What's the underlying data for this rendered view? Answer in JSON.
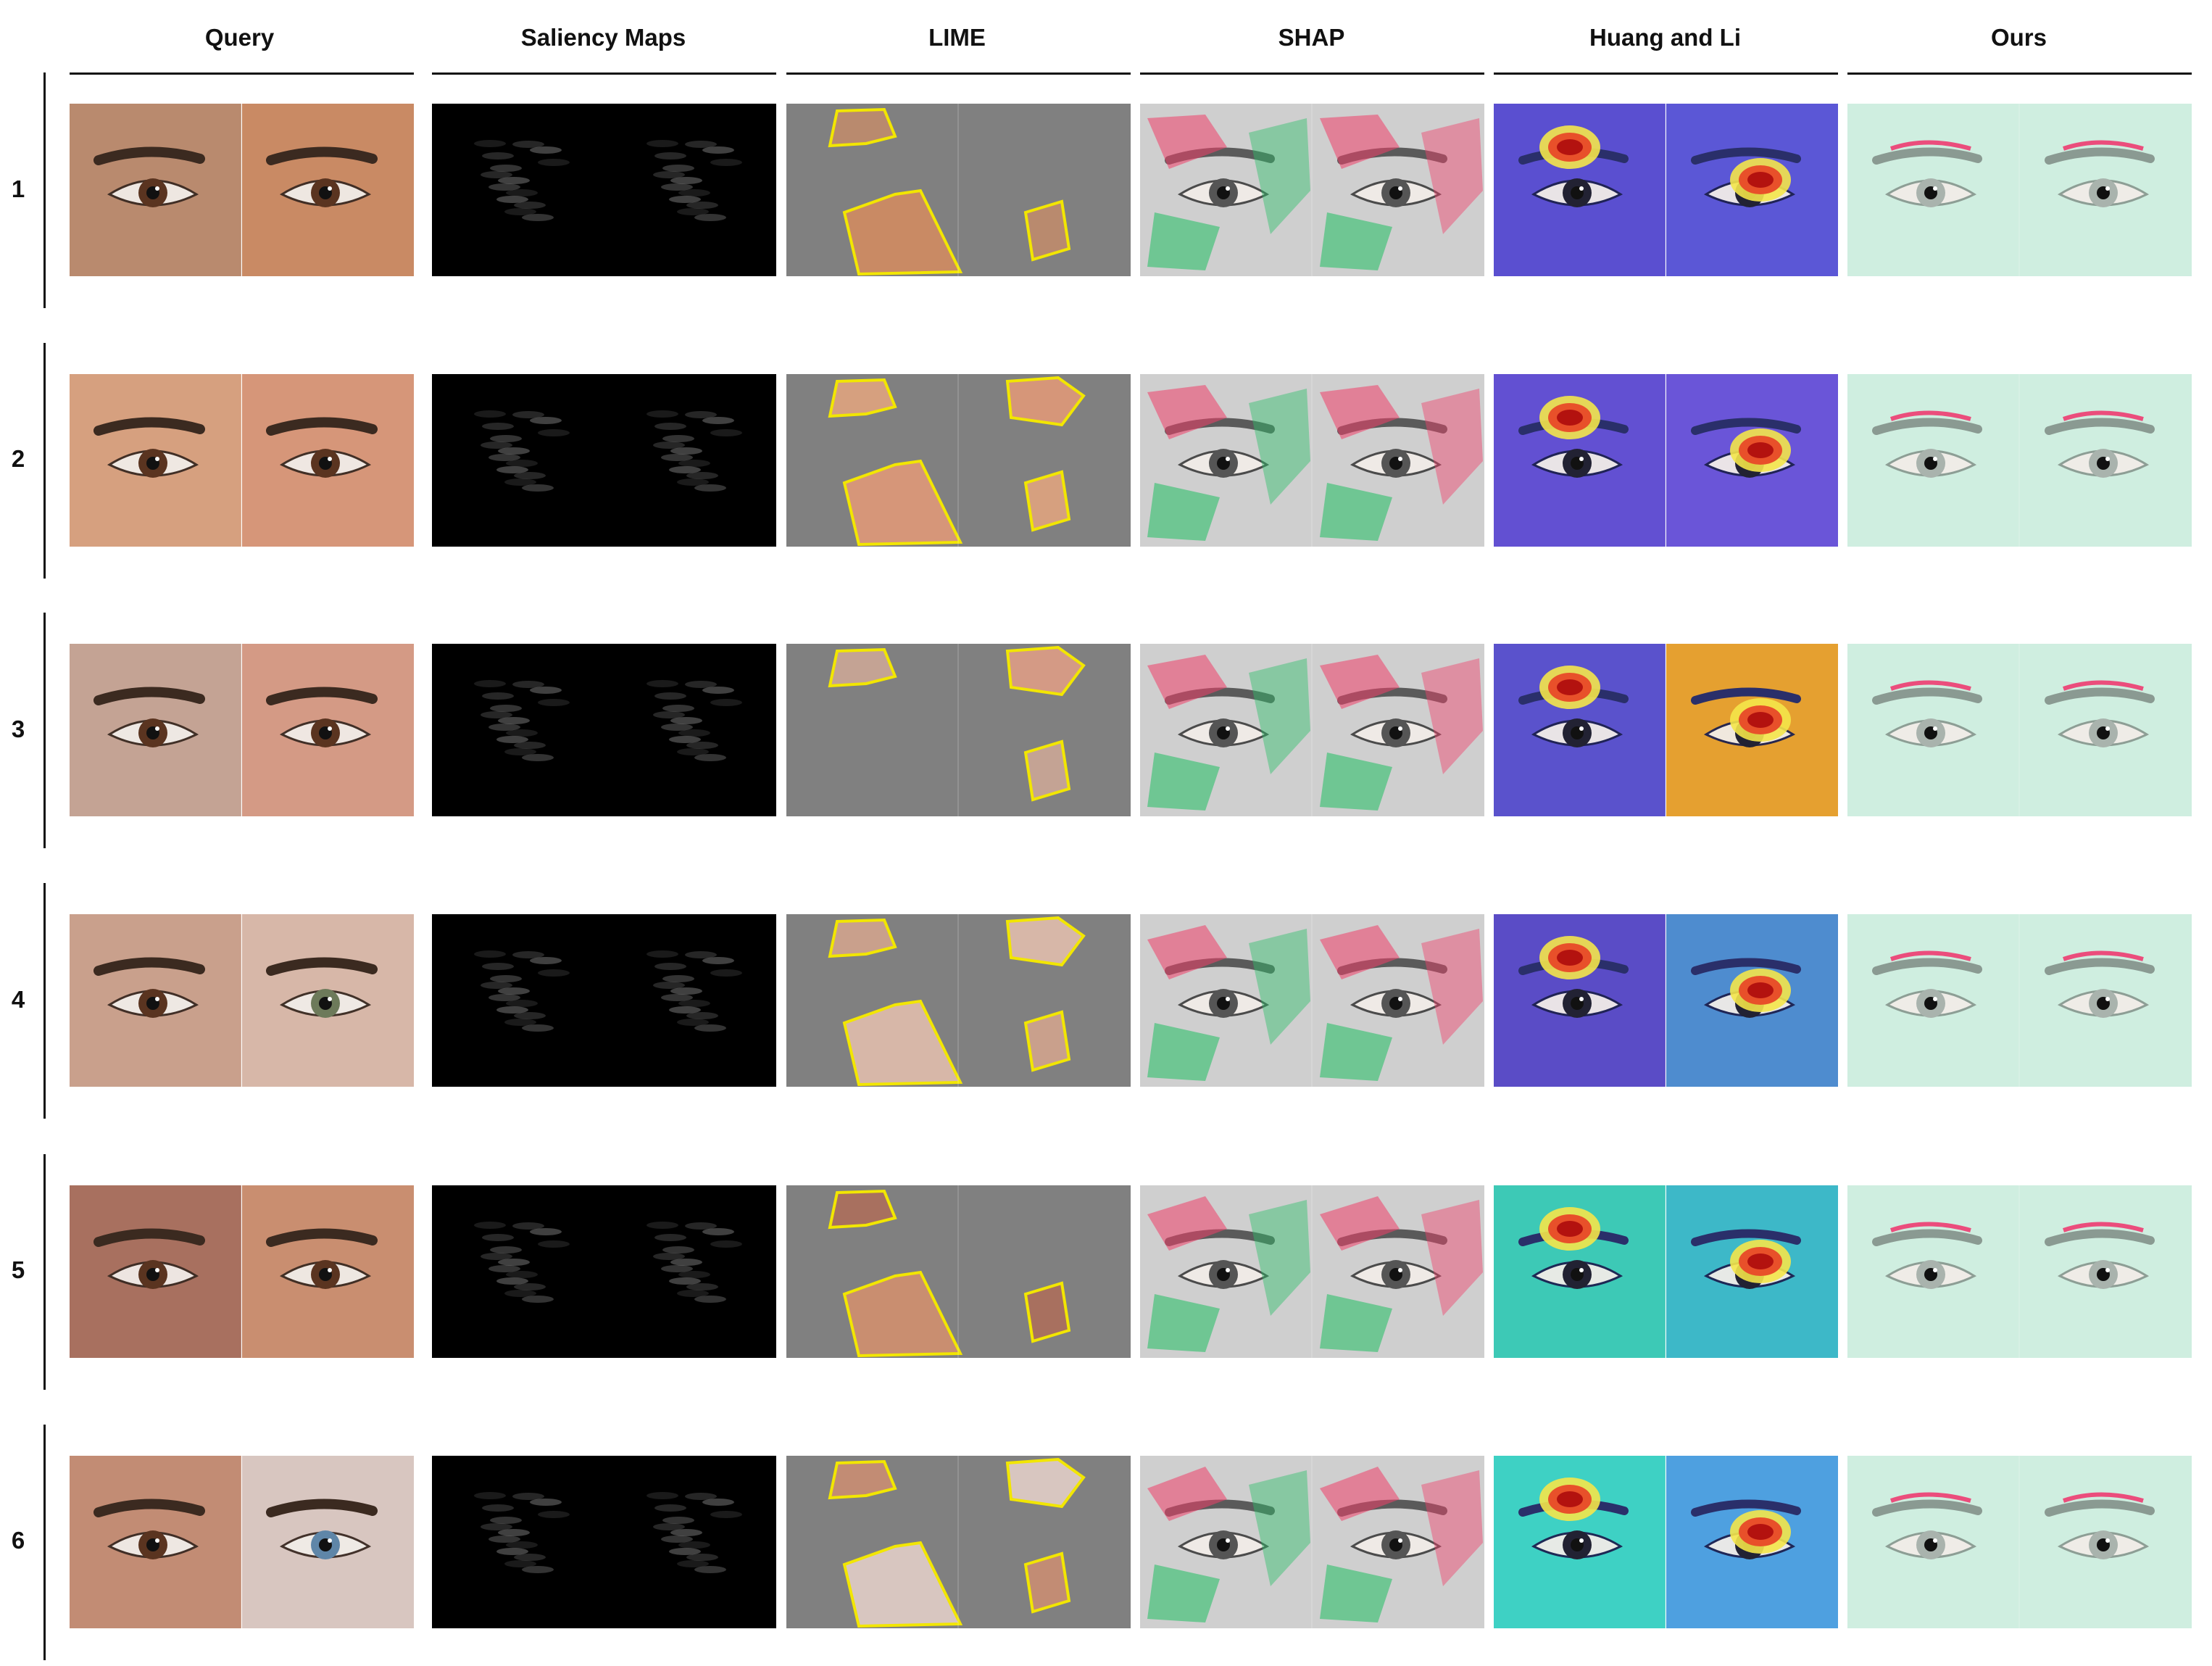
{
  "columns": [
    {
      "key": "query",
      "title": "Query"
    },
    {
      "key": "saliency",
      "title": "Saliency Maps"
    },
    {
      "key": "lime",
      "title": "LIME"
    },
    {
      "key": "shap",
      "title": "SHAP"
    },
    {
      "key": "huang",
      "title": "Huang and Li"
    },
    {
      "key": "ours",
      "title": "Ours"
    }
  ],
  "rows": [
    {
      "label": "1"
    },
    {
      "label": "2"
    },
    {
      "label": "3"
    },
    {
      "label": "4"
    },
    {
      "label": "5"
    },
    {
      "label": "6"
    }
  ]
}
